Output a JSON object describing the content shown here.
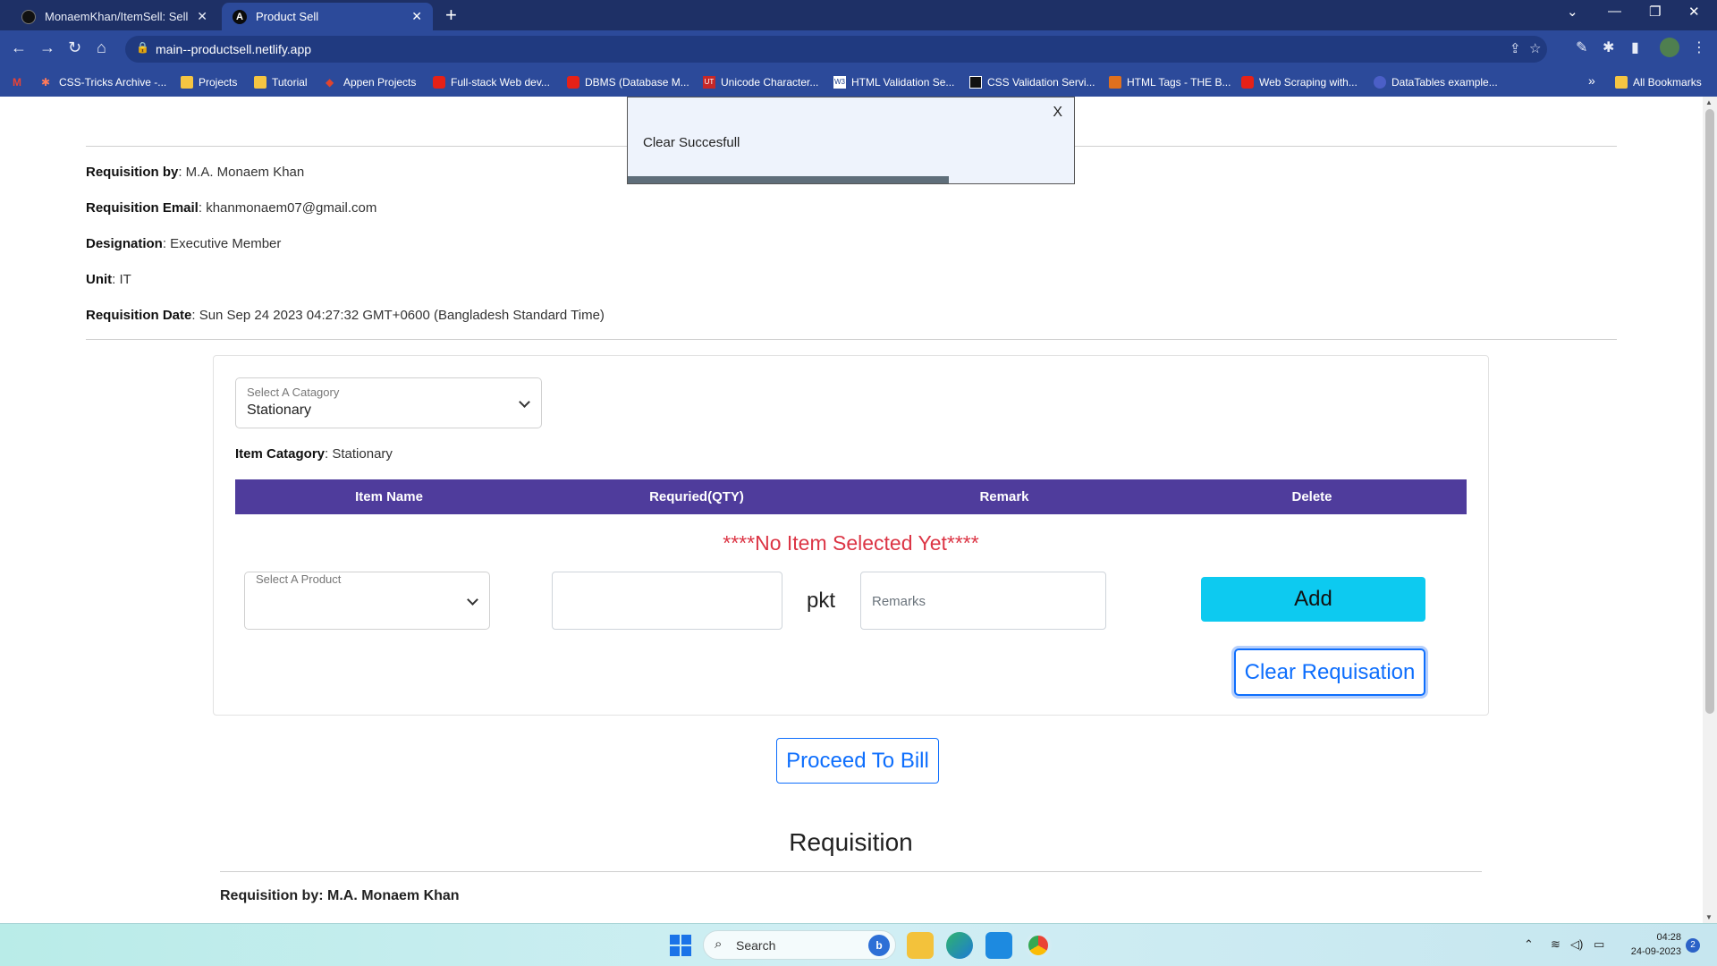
{
  "browser": {
    "tabs": [
      {
        "title": "MonaemKhan/ItemSell: Sell Prod",
        "active": false
      },
      {
        "title": "Product Sell",
        "active": true
      }
    ],
    "url": "main--productsell.netlify.app",
    "bookmarks": [
      {
        "label": "CSS-Tricks Archive -..."
      },
      {
        "label": "Projects"
      },
      {
        "label": "Tutorial"
      },
      {
        "label": "Appen Projects"
      },
      {
        "label": "Full-stack Web dev..."
      },
      {
        "label": "DBMS (Database M..."
      },
      {
        "label": "Unicode Character..."
      },
      {
        "label": "HTML Validation Se..."
      },
      {
        "label": "CSS Validation Servi..."
      },
      {
        "label": "HTML Tags - THE B..."
      },
      {
        "label": "Web Scraping with..."
      },
      {
        "label": "DataTables example..."
      }
    ],
    "all_bookmarks": "All Bookmarks"
  },
  "toast": {
    "message": "Clear Succesfull",
    "close": "X",
    "progress": 0.72
  },
  "requisition_info": {
    "by_label": "Requisition by",
    "by_value": ": M.A. Monaem Khan",
    "email_label": "Requisition Email",
    "email_value": ": khanmonaem07@gmail.com",
    "designation_label": "Designation",
    "designation_value": ": Executive Member",
    "unit_label": "Unit",
    "unit_value": ": IT",
    "date_label": "Requisition Date",
    "date_value": ": Sun Sep 24 2023 04:27:32 GMT+0600 (Bangladesh Standard Time)"
  },
  "form": {
    "category_label": "Select A Catagory",
    "category_value": "Stationary",
    "item_category_label": "Item Catagory",
    "item_category_value": ": Stationary",
    "table_headers": [
      "Item Name",
      "Requried(QTY)",
      "Remark",
      "Delete"
    ],
    "empty_message": "****No Item Selected Yet****",
    "product_label": "Select A Product",
    "product_value": "",
    "qty_value": "",
    "unit": "pkt",
    "remarks_placeholder": "Remarks",
    "add_button": "Add",
    "clear_button": "Clear Requisation"
  },
  "proceed_button": "Proceed To Bill",
  "requisition_section": {
    "title": "Requisition",
    "by": "Requisition by: M.A. Monaem Khan"
  },
  "taskbar": {
    "search": "Search",
    "time": "04:28",
    "date": "24-09-2023",
    "notifications": "2"
  },
  "colors": {
    "table_header": "#4f3c9c",
    "empty_message": "#dc3545",
    "add_button": "#0dcaf0",
    "primary": "#0d6efd",
    "browser_chrome": "#2c4a9a"
  }
}
